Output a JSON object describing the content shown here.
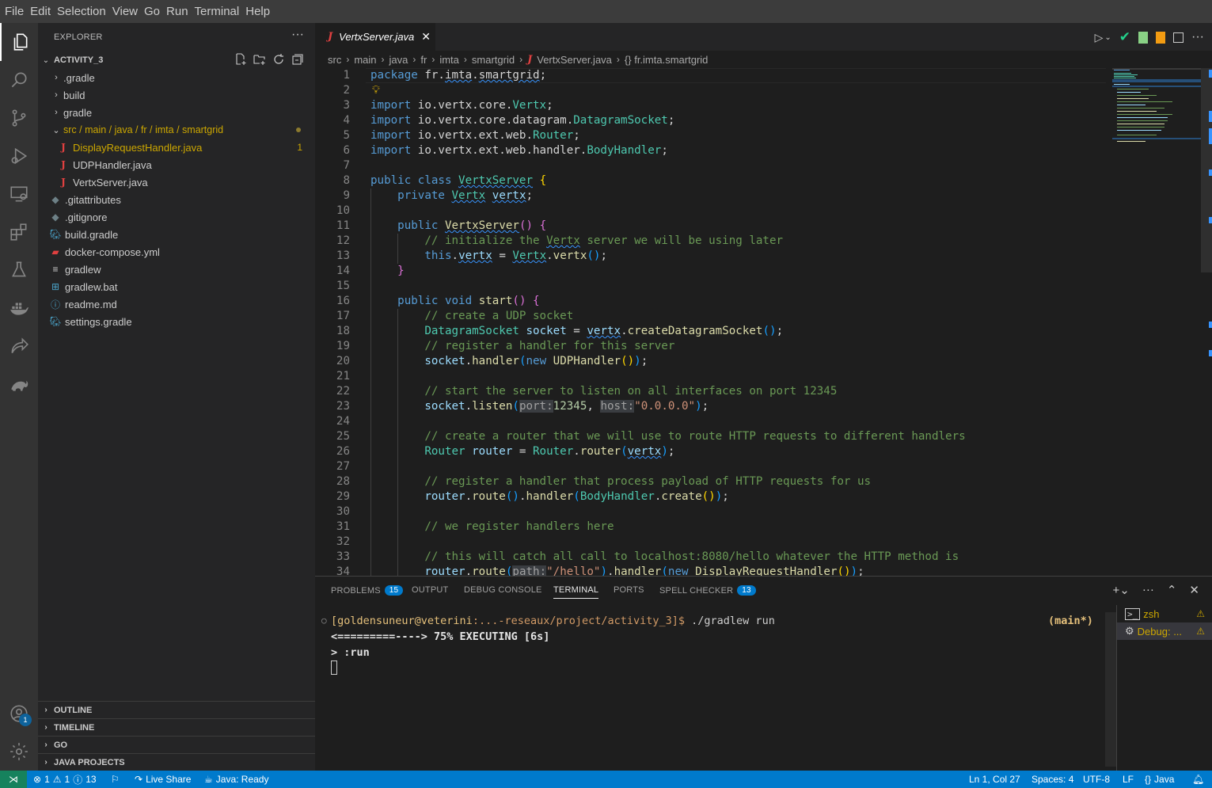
{
  "menu": [
    "File",
    "Edit",
    "Selection",
    "View",
    "Go",
    "Run",
    "Terminal",
    "Help"
  ],
  "explorer": {
    "title": "EXPLORER",
    "more": "···",
    "folder": "ACTIVITY_3",
    "items": [
      {
        "label": ".gradle",
        "kind": "folder"
      },
      {
        "label": "build",
        "kind": "folder"
      },
      {
        "label": "gradle",
        "kind": "folder"
      },
      {
        "label": "src / main / java / fr / imta / smartgrid",
        "kind": "folder-open"
      },
      {
        "label": "DisplayRequestHandler.java",
        "kind": "java",
        "count": "1"
      },
      {
        "label": "UDPHandler.java",
        "kind": "java"
      },
      {
        "label": "VertxServer.java",
        "kind": "java"
      },
      {
        "label": ".gitattributes",
        "kind": "git"
      },
      {
        "label": ".gitignore",
        "kind": "git"
      },
      {
        "label": "build.gradle",
        "kind": "gradle"
      },
      {
        "label": "docker-compose.yml",
        "kind": "docker"
      },
      {
        "label": "gradlew",
        "kind": "text"
      },
      {
        "label": "gradlew.bat",
        "kind": "bat"
      },
      {
        "label": "readme.md",
        "kind": "info"
      },
      {
        "label": "settings.gradle",
        "kind": "gradle"
      }
    ],
    "sections": [
      "OUTLINE",
      "TIMELINE",
      "GO",
      "JAVA PROJECTS"
    ]
  },
  "tab": {
    "icon": "J",
    "label": "VertxServer.java",
    "close": "✕"
  },
  "breadcrumb": [
    "src",
    "main",
    "java",
    "fr",
    "imta",
    "smartgrid",
    "VertxServer.java",
    "{} fr.imta.smartgrid"
  ],
  "editor": {
    "line_numbers": [
      "1",
      "2",
      "3",
      "4",
      "5",
      "6",
      "7",
      "8",
      "9",
      "10",
      "11",
      "12",
      "13",
      "14",
      "15",
      "16",
      "17",
      "18",
      "19",
      "20",
      "21",
      "22",
      "23",
      "24",
      "25",
      "26",
      "27",
      "28",
      "29",
      "30",
      "31",
      "32",
      "33",
      "34"
    ]
  },
  "panel": {
    "tabs": [
      {
        "label": "PROBLEMS",
        "badge": "15"
      },
      {
        "label": "OUTPUT"
      },
      {
        "label": "DEBUG CONSOLE"
      },
      {
        "label": "TERMINAL",
        "active": true
      },
      {
        "label": "PORTS"
      },
      {
        "label": "SPELL CHECKER",
        "badge": "13"
      }
    ],
    "terminal": {
      "prompt_user": "[goldensuneur@veterini",
      "prompt_path": ":...-reseaux/project/activity_3]$",
      "command": " ./gradlew run",
      "branch": "(main*)",
      "progress": "<=========----> 75% EXECUTING [6s]",
      "task": "> :run"
    },
    "terminals": [
      {
        "label": "zsh"
      },
      {
        "label": "Debug: ..."
      }
    ]
  },
  "status": {
    "errors": "1",
    "warnings": "1",
    "infos": "13",
    "live_share": "Live Share",
    "java": "Java: Ready",
    "position": "Ln 1, Col 27",
    "spaces": "Spaces: 4",
    "encoding": "UTF-8",
    "eol": "LF",
    "language": "Java"
  },
  "accounts_badge": "1",
  "colors": {
    "accent": "#007acc",
    "remote": "#16825d",
    "warning": "#cca700",
    "java_icon": "#e04040"
  }
}
